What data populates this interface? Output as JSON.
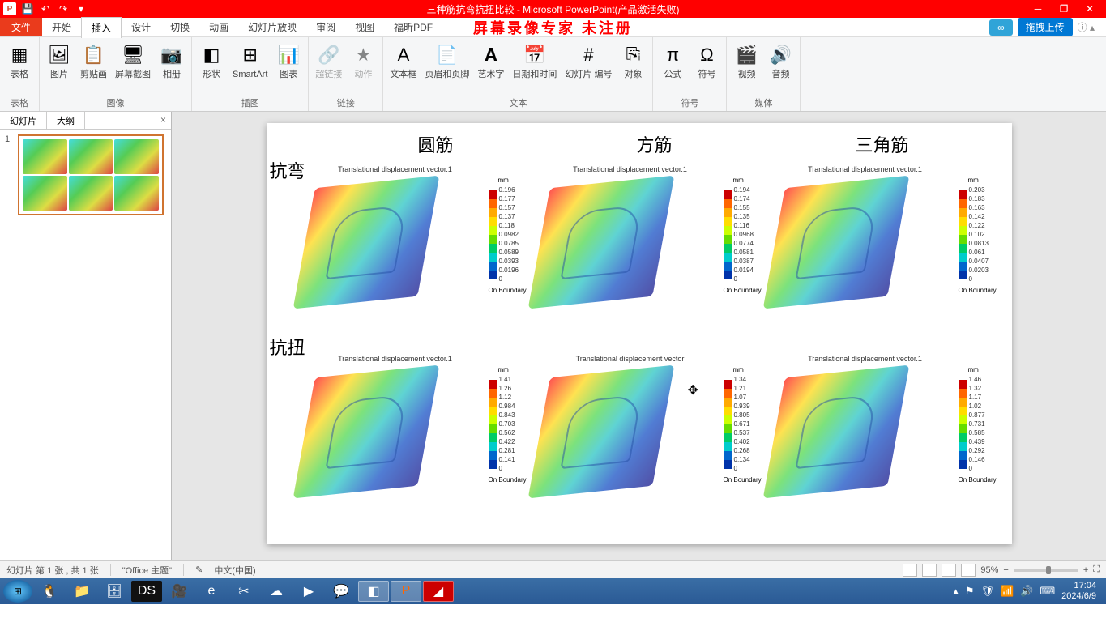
{
  "titlebar": {
    "app_icon_letter": "P",
    "title": "三种筋抗弯抗扭比较 - Microsoft PowerPoint(产品激活失败)"
  },
  "ribbon": {
    "file": "文件",
    "tabs": [
      "开始",
      "插入",
      "设计",
      "切换",
      "动画",
      "幻灯片放映",
      "审阅",
      "视图",
      "福昕PDF"
    ],
    "active_tab_index": 1,
    "watermark": "屏幕录像专家  未注册",
    "cloud_icon": "∞",
    "upload": "拖拽上传"
  },
  "groups": {
    "tables": {
      "label": "表格",
      "items": [
        {
          "icon": "▦",
          "label": "表格"
        }
      ]
    },
    "images": {
      "label": "图像",
      "items": [
        {
          "icon": "🖼",
          "label": "图片"
        },
        {
          "icon": "📋",
          "label": "剪贴画"
        },
        {
          "icon": "🖥",
          "label": "屏幕截图"
        },
        {
          "icon": "📷",
          "label": "相册"
        }
      ]
    },
    "illus": {
      "label": "插图",
      "items": [
        {
          "icon": "◧",
          "label": "形状"
        },
        {
          "icon": "⊞",
          "label": "SmartArt"
        },
        {
          "icon": "📊",
          "label": "图表"
        }
      ]
    },
    "links": {
      "label": "链接",
      "items": [
        {
          "icon": "🔗",
          "label": "超链接",
          "disabled": true
        },
        {
          "icon": "★",
          "label": "动作",
          "disabled": true
        }
      ]
    },
    "text": {
      "label": "文本",
      "items": [
        {
          "icon": "A",
          "label": "文本框"
        },
        {
          "icon": "📄",
          "label": "页眉和页脚"
        },
        {
          "icon": "𝐀",
          "label": "艺术字"
        },
        {
          "icon": "📅",
          "label": "日期和时间"
        },
        {
          "icon": "#",
          "label": "幻灯片\n编号"
        },
        {
          "icon": "⎘",
          "label": "对象"
        }
      ]
    },
    "symbols": {
      "label": "符号",
      "items": [
        {
          "icon": "π",
          "label": "公式"
        },
        {
          "icon": "Ω",
          "label": "符号"
        }
      ]
    },
    "media": {
      "label": "媒体",
      "items": [
        {
          "icon": "🎬",
          "label": "视频"
        },
        {
          "icon": "🔊",
          "label": "音频"
        }
      ]
    }
  },
  "side": {
    "tab_slides": "幻灯片",
    "tab_outline": "大纲",
    "slide_num": "1"
  },
  "slide": {
    "columns": [
      "圆筋",
      "方筋",
      "三角筋"
    ],
    "rows": [
      "抗弯",
      "抗扭"
    ],
    "legend_unit": "mm",
    "legend_footer": "On Boundary"
  },
  "chart_data": [
    {
      "row": "抗弯",
      "col": "圆筋",
      "title": "Translational displacement vector.1",
      "type": "heatmap",
      "unit": "mm",
      "values": [
        0.196,
        0.177,
        0.157,
        0.137,
        0.118,
        0.0982,
        0.0785,
        0.0589,
        0.0393,
        0.0196,
        0
      ],
      "footer": "On Boundary"
    },
    {
      "row": "抗弯",
      "col": "方筋",
      "title": "Translational displacement vector.1",
      "type": "heatmap",
      "unit": "mm",
      "values": [
        0.194,
        0.174,
        0.155,
        0.135,
        0.116,
        0.0968,
        0.0774,
        0.0581,
        0.0387,
        0.0194,
        0
      ],
      "footer": "On Boundary"
    },
    {
      "row": "抗弯",
      "col": "三角筋",
      "title": "Translational displacement vector.1",
      "type": "heatmap",
      "unit": "mm",
      "values": [
        0.203,
        0.183,
        0.163,
        0.142,
        0.122,
        0.102,
        0.0813,
        0.061,
        0.0407,
        0.0203,
        0
      ],
      "footer": "On Boundary"
    },
    {
      "row": "抗扭",
      "col": "圆筋",
      "title": "Translational displacement vector.1",
      "type": "heatmap",
      "unit": "mm",
      "values": [
        1.41,
        1.26,
        1.12,
        0.984,
        0.843,
        0.703,
        0.562,
        0.422,
        0.281,
        0.141,
        0
      ],
      "footer": "On Boundary"
    },
    {
      "row": "抗扭",
      "col": "方筋",
      "title": "Translational displacement vector",
      "type": "heatmap",
      "unit": "mm",
      "values": [
        1.34,
        1.21,
        1.07,
        0.939,
        0.805,
        0.671,
        0.537,
        0.402,
        0.268,
        0.134,
        0
      ],
      "footer": "On Boundary"
    },
    {
      "row": "抗扭",
      "col": "三角筋",
      "title": "Translational displacement vector.1",
      "type": "heatmap",
      "unit": "mm",
      "values": [
        1.46,
        1.32,
        1.17,
        1.02,
        0.877,
        0.731,
        0.585,
        0.439,
        0.292,
        0.146,
        0
      ],
      "footer": "On Boundary"
    }
  ],
  "statusbar": {
    "slide_info": "幻灯片 第 1 张 , 共 1 张",
    "theme": "\"Office 主题\"",
    "lang": "中文(中国)",
    "zoom": "95%"
  },
  "taskbar": {
    "time": "17:04",
    "date": "2024/6/9"
  }
}
